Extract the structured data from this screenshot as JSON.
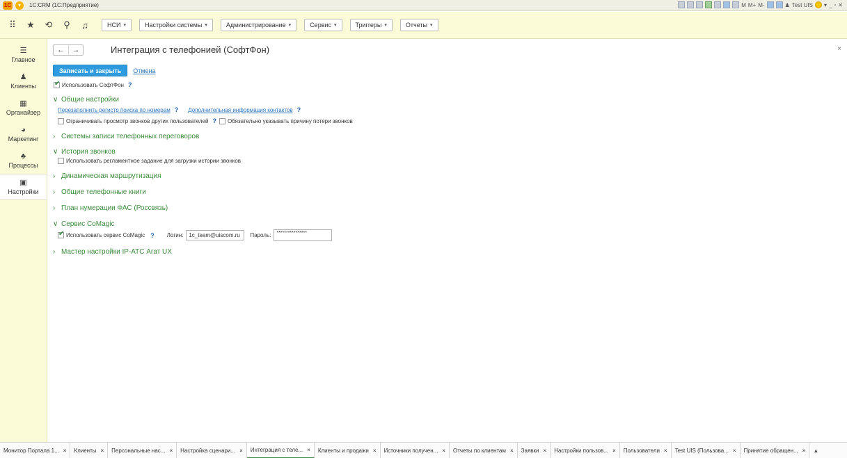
{
  "window": {
    "title": "1С:CRM (1С:Предприятие)",
    "user": "Test UIS",
    "mem_labels": [
      "M",
      "M+",
      "M-"
    ]
  },
  "topnav": {
    "buttons": [
      "НСИ",
      "Настройки системы",
      "Администрирование",
      "Сервис",
      "Триггеры",
      "Отчеты"
    ]
  },
  "sidebar": {
    "items": [
      {
        "label": "Главное",
        "icon": "menu-icon"
      },
      {
        "label": "Клиенты",
        "icon": "people-icon"
      },
      {
        "label": "Органайзер",
        "icon": "calendar-icon"
      },
      {
        "label": "Маркетинг",
        "icon": "pie-chart-icon"
      },
      {
        "label": "Процессы",
        "icon": "hierarchy-icon"
      },
      {
        "label": "Настройки",
        "icon": "settings-icon"
      }
    ],
    "active_index": 5
  },
  "page": {
    "title": "Интеграция с телефонией (СофтФон)",
    "save_close": "Записать и закрыть",
    "cancel": "Отмена",
    "use_softphone": "Использовать СофтФон",
    "help": "?"
  },
  "sections": {
    "general": {
      "title": "Общие настройки",
      "link1": "Перезаполнить регистр поиска по номерам",
      "link2": "Дополнительная информация контактов",
      "cb1": "Ограничивать просмотр звонков других пользователей",
      "cb2": "Обязательно указывать причину потери звонков"
    },
    "recording": {
      "title": "Системы записи телефонных переговоров"
    },
    "history": {
      "title": "История звонков",
      "cb1": "Использовать регламентное задание для загрузки истории звонков"
    },
    "routing": {
      "title": "Динамическая маршрутизация"
    },
    "phonebooks": {
      "title": "Общие телефонные книги"
    },
    "numbering": {
      "title": "План нумерации ФАС (Россвязь)"
    },
    "comagic": {
      "title": "Сервис CoMagic",
      "use_label": "Использовать сервис CoMagic",
      "login_label": "Логин:",
      "login_value": "1c_team@uiscom.ru",
      "password_label": "Пароль:",
      "password_value": "****************"
    },
    "agat": {
      "title": "Мастер настройки IP-АТС Агат UX"
    }
  },
  "tabs": [
    "Монитор Портала 1...",
    "Клиенты",
    "Персональные нас...",
    "Настройка сценари...",
    "Интеграция с теле...",
    "Клиенты и продажи",
    "Источники получен...",
    "Отчеты по клиентам",
    "Заявки",
    "Настройки пользов...",
    "Пользователи",
    "Test UIS (Пользова...",
    "Принятие обращен..."
  ],
  "active_tab_index": 4,
  "colors": {
    "panel_bg": "#fbfbd7",
    "primary_button": "#2e9be0",
    "section_title": "#3b8a3b",
    "link": "#2a73c0"
  }
}
